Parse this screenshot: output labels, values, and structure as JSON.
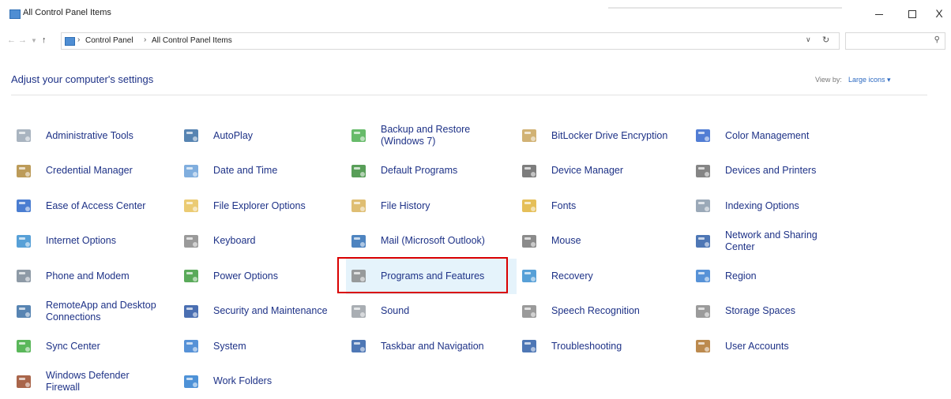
{
  "window": {
    "title": "All Control Panel Items",
    "minimize_label": "–",
    "maximize_label": "□",
    "close_label": "X"
  },
  "address": {
    "crumbs": [
      "Control Panel",
      "All Control Panel Items"
    ],
    "separator": "›",
    "search_placeholder": ""
  },
  "header": {
    "title": "Adjust your computer's settings",
    "view_by_label": "View by:",
    "view_by_value": "Large icons ▾"
  },
  "items": [
    {
      "label": "Administrative Tools",
      "icon": "admin-tools-icon",
      "color": "#9aa7b5"
    },
    {
      "label": "AutoPlay",
      "icon": "autoplay-icon",
      "color": "#3a6ea5"
    },
    {
      "label": "Backup and Restore (Windows 7)",
      "icon": "backup-icon",
      "color": "#4caf50"
    },
    {
      "label": "BitLocker Drive Encryption",
      "icon": "bitlocker-icon",
      "color": "#c9a45c"
    },
    {
      "label": "Color Management",
      "icon": "color-management-icon",
      "color": "#3366cc"
    },
    {
      "label": "Credential Manager",
      "icon": "credential-manager-icon",
      "color": "#b08a3c"
    },
    {
      "label": "Date and Time",
      "icon": "date-time-icon",
      "color": "#6aa0d8"
    },
    {
      "label": "Default Programs",
      "icon": "default-programs-icon",
      "color": "#3b8d3b"
    },
    {
      "label": "Device Manager",
      "icon": "device-manager-icon",
      "color": "#666666"
    },
    {
      "label": "Devices and Printers",
      "icon": "devices-printers-icon",
      "color": "#707070"
    },
    {
      "label": "Ease of Access Center",
      "icon": "ease-of-access-icon",
      "color": "#2a66c9"
    },
    {
      "label": "File Explorer Options",
      "icon": "file-explorer-options-icon",
      "color": "#e8c25a"
    },
    {
      "label": "File History",
      "icon": "file-history-icon",
      "color": "#d9b35a"
    },
    {
      "label": "Fonts",
      "icon": "fonts-icon",
      "color": "#e0b43c"
    },
    {
      "label": "Indexing Options",
      "icon": "indexing-options-icon",
      "color": "#8a9aab"
    },
    {
      "label": "Internet Options",
      "icon": "internet-options-icon",
      "color": "#3a8fd0"
    },
    {
      "label": "Keyboard",
      "icon": "keyboard-icon",
      "color": "#888888"
    },
    {
      "label": "Mail (Microsoft Outlook)",
      "icon": "mail-icon",
      "color": "#2f6fb5"
    },
    {
      "label": "Mouse",
      "icon": "mouse-icon",
      "color": "#777777"
    },
    {
      "label": "Network and Sharing Center",
      "icon": "network-sharing-icon",
      "color": "#2f5fa8"
    },
    {
      "label": "Phone and Modem",
      "icon": "phone-modem-icon",
      "color": "#7a8896"
    },
    {
      "label": "Power Options",
      "icon": "power-options-icon",
      "color": "#3d9b3d"
    },
    {
      "label": "Programs and Features",
      "icon": "programs-features-icon",
      "color": "#8a8a8a",
      "highlight": true
    },
    {
      "label": "Recovery",
      "icon": "recovery-icon",
      "color": "#3a8fd0"
    },
    {
      "label": "Region",
      "icon": "region-icon",
      "color": "#3a7fd0"
    },
    {
      "label": "RemoteApp and Desktop Connections",
      "icon": "remoteapp-icon",
      "color": "#3a6ea5"
    },
    {
      "label": "Security and Maintenance",
      "icon": "security-maintenance-icon",
      "color": "#2a56a5"
    },
    {
      "label": "Sound",
      "icon": "sound-icon",
      "color": "#9aa0a6"
    },
    {
      "label": "Speech Recognition",
      "icon": "speech-recognition-icon",
      "color": "#888888"
    },
    {
      "label": "Storage Spaces",
      "icon": "storage-spaces-icon",
      "color": "#8a8a8a"
    },
    {
      "label": "Sync Center",
      "icon": "sync-center-icon",
      "color": "#3daa3d"
    },
    {
      "label": "System",
      "icon": "system-icon",
      "color": "#3a7fd0"
    },
    {
      "label": "Taskbar and Navigation",
      "icon": "taskbar-navigation-icon",
      "color": "#2f5fa8"
    },
    {
      "label": "Troubleshooting",
      "icon": "troubleshooting-icon",
      "color": "#2f5fa8"
    },
    {
      "label": "User Accounts",
      "icon": "user-accounts-icon",
      "color": "#b0752f"
    },
    {
      "label": "Windows Defender Firewall",
      "icon": "firewall-icon",
      "color": "#9a4a2a"
    },
    {
      "label": "Work Folders",
      "icon": "work-folders-icon",
      "color": "#2f7fd0"
    }
  ]
}
